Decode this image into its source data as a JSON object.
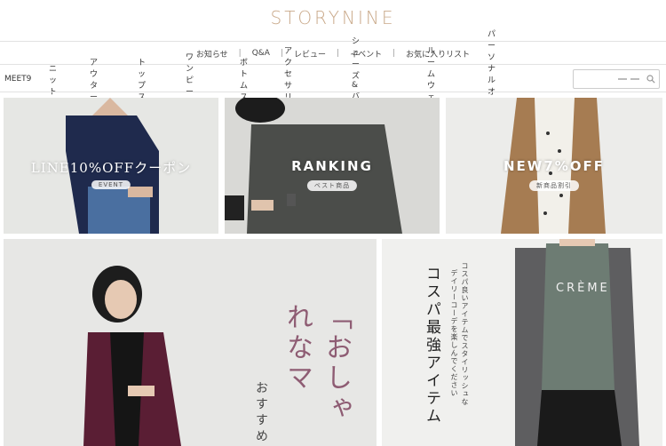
{
  "brand": {
    "logo_text": "STORYNINE"
  },
  "sub_nav": {
    "items": [
      "お知らせ",
      "Q&A",
      "レビュー",
      "イベント",
      "お気に入りリスト"
    ]
  },
  "main_nav": {
    "items": [
      "MEET9",
      "ニット",
      "アウター",
      "トップス",
      "ワンピース",
      "ボトムス",
      "アクセサリー",
      "シューズ&バッグ",
      "ルームウェア",
      "パーソナルオーダー"
    ]
  },
  "search": {
    "placeholder": ""
  },
  "banners": [
    {
      "caption": "LINE10%OFFクーポン",
      "tag": "EVENT"
    },
    {
      "caption": "RANKING",
      "tag": "ベスト商品"
    },
    {
      "caption": "NEW7%OFF",
      "tag": "新商品割引"
    }
  ],
  "feature_left": {
    "headline": "「おしゃれなマ",
    "sub": "おすすめ"
  },
  "feature_right": {
    "title": "コスパ最強アイテム",
    "desc_line1": "コスパ良いアイテムでスタイリッシュな",
    "desc_line2": "デイリーコーデを楽しんでください",
    "shirt_print": "CRÈME"
  },
  "colors": {
    "logo": "#c9a98a",
    "text": "#333333"
  }
}
